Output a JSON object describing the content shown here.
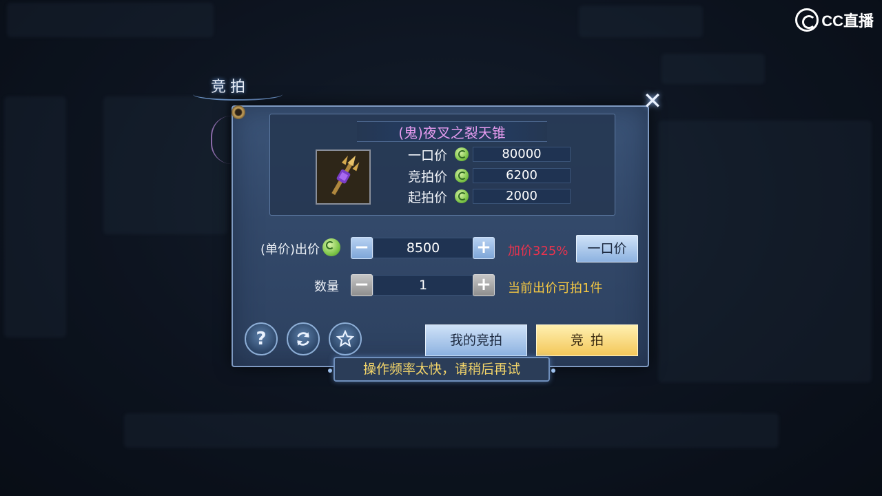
{
  "watermark": {
    "text": "CC直播"
  },
  "tab": {
    "title": "竞拍"
  },
  "item": {
    "name": "(鬼)夜叉之裂天锥",
    "icon": "trident-weapon-icon",
    "prices": [
      {
        "label": "一口价",
        "value": "80000"
      },
      {
        "label": "竞拍价",
        "value": "6200"
      },
      {
        "label": "起拍价",
        "value": "2000"
      }
    ]
  },
  "bid": {
    "label": "(单价)出价",
    "value": "8500",
    "markup_hint": "加价325%",
    "buyout_label": "一口价"
  },
  "quantity": {
    "label": "数量",
    "value": "1",
    "hint": "当前出价可拍1件"
  },
  "buttons": {
    "help_icon": "question-icon",
    "refresh_icon": "refresh-icon",
    "favorite_icon": "star-icon",
    "my_bids": "我的竞拍",
    "bid": "竞拍"
  },
  "toast": {
    "text": "操作频率太快，请稍后再试"
  },
  "colors": {
    "item_name": "#e79cf0",
    "markup_hint": "#e8334e",
    "quantity_hint": "#f3c743",
    "toast_text": "#f3d56a",
    "bid_button": "#f3c75a"
  }
}
